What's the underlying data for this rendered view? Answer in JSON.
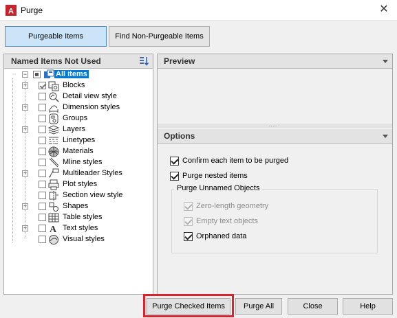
{
  "window": {
    "title": "Purge",
    "close_glyph": "✕"
  },
  "tabs": [
    {
      "label": "Purgeable Items",
      "active": true
    },
    {
      "label": "Find Non-Purgeable Items",
      "active": false
    }
  ],
  "left_panel": {
    "header": "Named Items Not Used",
    "sort_icon": "sort-icon",
    "root": {
      "label": "All items",
      "icon": "all-items-icon"
    },
    "items": [
      {
        "label": "Blocks",
        "expandable": true,
        "checked": true,
        "icon": "blocks-icon"
      },
      {
        "label": "Detail view style",
        "expandable": false,
        "checked": false,
        "icon": "detail-view-icon"
      },
      {
        "label": "Dimension styles",
        "expandable": true,
        "checked": false,
        "icon": "dimension-icon"
      },
      {
        "label": "Groups",
        "expandable": false,
        "checked": false,
        "icon": "groups-icon"
      },
      {
        "label": "Layers",
        "expandable": true,
        "checked": false,
        "icon": "layers-icon"
      },
      {
        "label": "Linetypes",
        "expandable": false,
        "checked": false,
        "icon": "linetypes-icon"
      },
      {
        "label": "Materials",
        "expandable": false,
        "checked": false,
        "icon": "materials-icon"
      },
      {
        "label": "Mline styles",
        "expandable": false,
        "checked": false,
        "icon": "mline-icon"
      },
      {
        "label": "Multileader Styles",
        "expandable": true,
        "checked": false,
        "icon": "multileader-icon"
      },
      {
        "label": "Plot styles",
        "expandable": false,
        "checked": false,
        "icon": "plot-icon"
      },
      {
        "label": "Section view style",
        "expandable": false,
        "checked": false,
        "icon": "section-view-icon"
      },
      {
        "label": "Shapes",
        "expandable": true,
        "checked": false,
        "icon": "shapes-icon"
      },
      {
        "label": "Table styles",
        "expandable": false,
        "checked": false,
        "icon": "table-icon"
      },
      {
        "label": "Text styles",
        "expandable": true,
        "checked": false,
        "icon": "text-style-icon"
      },
      {
        "label": "Visual styles",
        "expandable": false,
        "checked": false,
        "icon": "visual-styles-icon"
      }
    ]
  },
  "preview": {
    "header": "Preview"
  },
  "options": {
    "header": "Options",
    "confirm_label": "Confirm each item to be purged",
    "confirm_checked": true,
    "nested_label": "Purge nested items",
    "nested_checked": true,
    "group_title": "Purge Unnamed Objects",
    "zero_length_label": "Zero-length geometry",
    "empty_text_label": "Empty text objects",
    "orphaned_label": "Orphaned data",
    "orphaned_checked": true
  },
  "buttons": {
    "purge_checked": "Purge Checked Items",
    "purge_all": "Purge All",
    "close": "Close",
    "help": "Help"
  },
  "colors": {
    "selection": "#0078d7",
    "highlight_frame": "#d9232d",
    "active_tab": "#cce4f7"
  }
}
